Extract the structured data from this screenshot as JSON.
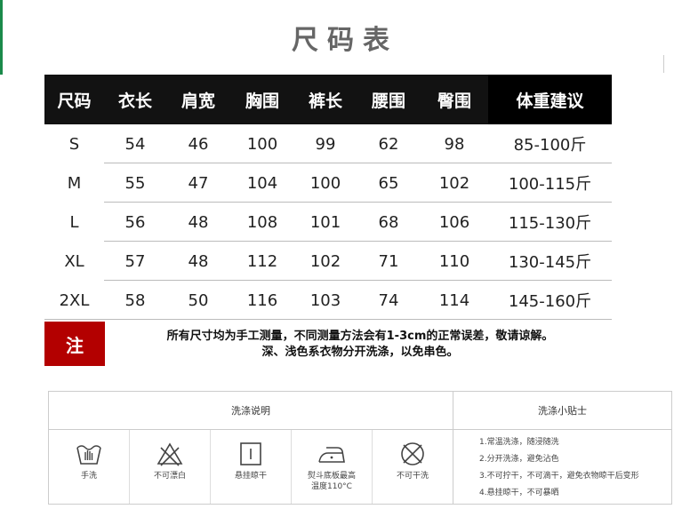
{
  "page_title": "尺码表",
  "table": {
    "headers": [
      "尺码",
      "衣长",
      "肩宽",
      "胸围",
      "裤长",
      "腰围",
      "臀围",
      "体重建议"
    ],
    "rows": [
      [
        "S",
        "54",
        "46",
        "100",
        "99",
        "62",
        "98",
        "85-100斤"
      ],
      [
        "M",
        "55",
        "47",
        "104",
        "100",
        "65",
        "102",
        "100-115斤"
      ],
      [
        "L",
        "56",
        "48",
        "108",
        "101",
        "68",
        "106",
        "115-130斤"
      ],
      [
        "XL",
        "57",
        "48",
        "112",
        "102",
        "71",
        "110",
        "130-145斤"
      ],
      [
        "2XL",
        "58",
        "50",
        "116",
        "103",
        "74",
        "114",
        "145-160斤"
      ]
    ]
  },
  "note": {
    "badge": "注",
    "line1": "所有尺寸均为手工测量，不同测量方法会有1-3cm的正常误差，敬请谅解。",
    "line2": "深、浅色系衣物分开洗涤，以免串色。"
  },
  "care": {
    "title": "洗涤说明",
    "tips_title": "洗涤小贴士",
    "icons": [
      {
        "icon": "hand-wash-icon",
        "label": "手洗"
      },
      {
        "icon": "no-bleach-icon",
        "label": "不可漂白"
      },
      {
        "icon": "hang-dry-icon",
        "label": "悬挂晾干"
      },
      {
        "icon": "iron-icon",
        "label": "熨斗底板最高\n温度110°C"
      },
      {
        "icon": "no-dry-clean-icon",
        "label": "不可干洗"
      }
    ],
    "tips": [
      "1.常温洗涤，随浸随洗",
      "2.分开洗涤，避免沾色",
      "3.不可拧干，不可滴干，避免衣物晾干后变形",
      "4.悬挂晾干，不可暴晒"
    ]
  }
}
